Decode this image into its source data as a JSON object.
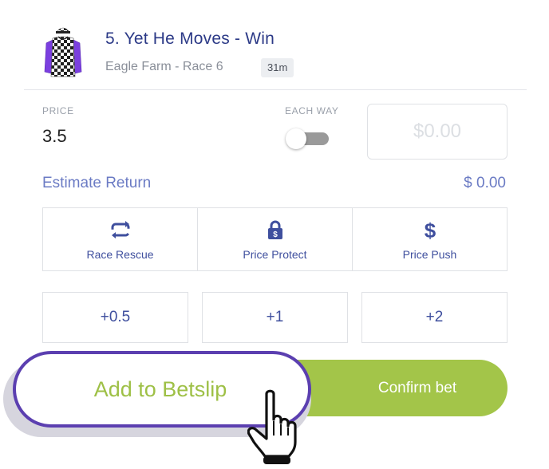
{
  "runner": {
    "title": "5. Yet He Moves - Win",
    "meeting": "Eagle Farm - Race 6",
    "time_to_jump": "31m",
    "silks_icon": "jockey-silks-icon"
  },
  "bet": {
    "price_label": "PRICE",
    "price_value": "3.5",
    "each_way_label": "EACH WAY",
    "each_way_on": false,
    "stake_placeholder": "$0.00",
    "stake_value": "",
    "estimate_label": "Estimate Return",
    "estimate_value": "$ 0.00"
  },
  "features": [
    {
      "label": "Race Rescue",
      "icon": "refresh-icon"
    },
    {
      "label": "Price Protect",
      "icon": "lock-icon"
    },
    {
      "label": "Price Push",
      "icon": "dollar-icon"
    }
  ],
  "quick_stakes": [
    "+0.5",
    "+1",
    "+2"
  ],
  "actions": {
    "add_label": "Add to Betslip",
    "confirm_label": "Confirm bet"
  },
  "colors": {
    "title": "#2c3a87",
    "accent_blue": "#3f4f9e",
    "estimate_text": "#6b7bc4",
    "confirm_green": "#a3c549",
    "add_text_green": "#9ec046",
    "add_border_purple": "#5b3fb0",
    "silks_purple": "#7b3fe0"
  },
  "cursor_icon": "pointing-hand-cursor-icon"
}
